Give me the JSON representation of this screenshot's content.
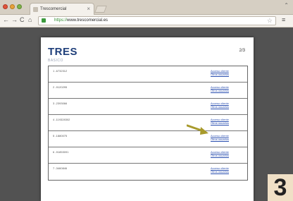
{
  "browser": {
    "tab_title": "Trescomercial",
    "tab_close": "×",
    "url_scheme": "https://",
    "url_rest": "www.trescomercial.es",
    "nav": {
      "back": "←",
      "forward": "→",
      "reload": "C",
      "home": "⌂"
    },
    "star": "☆",
    "menu": "≡",
    "user": "⌃"
  },
  "document": {
    "logo": "TRES",
    "subtitle": "BASICO",
    "page_number": "2/3",
    "rows": [
      {
        "label": "1 -6732312",
        "link1": "Acceso cliente",
        "link2": "Otros usuarios"
      },
      {
        "label": "2 -9120295",
        "link1": "Acceso cliente",
        "link2": "Otros usuarios"
      },
      {
        "label": "3 -2393066",
        "link1": "Acceso cliente",
        "link2": "Otros usuarios"
      },
      {
        "label": "4 -119328302",
        "link1": "Acceso cliente",
        "link2": "Otros usuarios"
      },
      {
        "label": "5 -1880075",
        "link1": "Acceso cliente",
        "link2": "Otros usuarios"
      },
      {
        "label": "6 -91853091",
        "link1": "Acceso cliente",
        "link2": "Otros usuarios"
      },
      {
        "label": "7 -3460846",
        "link1": "Acceso cliente",
        "link2": "Otros usuarios"
      }
    ]
  },
  "annotation": {
    "step": "3",
    "arrow_color": "#a89a2c"
  }
}
